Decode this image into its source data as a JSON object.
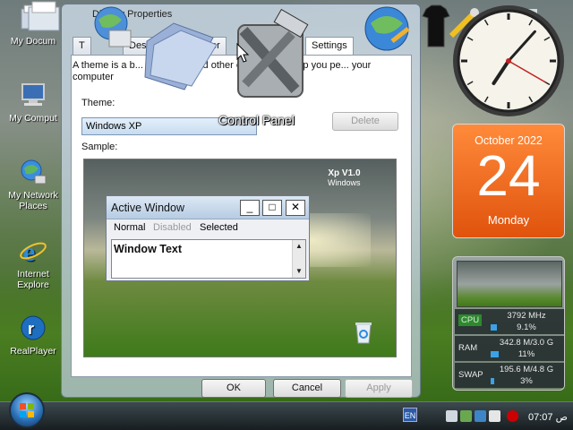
{
  "desktop": {
    "icons": [
      {
        "label": "My Docum"
      },
      {
        "label": "My Comput"
      },
      {
        "label": "My Network Places"
      },
      {
        "label": "Internet Explore"
      },
      {
        "label": "RealPlayer"
      }
    ]
  },
  "dialog": {
    "title": "Display Properties",
    "tabs": [
      "T",
      "Desk",
      "er",
      "A",
      "Settings"
    ],
    "description": "A theme is a b... a set of ... and other elements to help you pe... your computer",
    "theme_label": "Theme:",
    "theme_value": "Windows XP",
    "delete_label": "Delete",
    "sample_label": "Sample:",
    "ok_label": "OK",
    "cancel_label": "Cancel",
    "apply_label": "Apply"
  },
  "sample": {
    "logo_line1": "Xp V1.0",
    "logo_line2": "Windows",
    "active_window_title": "Active Window",
    "menu": [
      "Normal",
      "Disabled",
      "Selected"
    ],
    "window_text": "Window Text"
  },
  "overlay": {
    "control_panel_label": "Control Panel"
  },
  "calendar": {
    "month": "October 2022",
    "day": "24",
    "weekday": "Monday"
  },
  "meter": {
    "cpu": {
      "name": "CPU",
      "value": "3792 MHz",
      "percent": "9.1%",
      "fraction": 0.091
    },
    "ram": {
      "name": "RAM",
      "value": "342.8 M/3.0 G",
      "percent": "11%",
      "fraction": 0.11
    },
    "swap": {
      "name": "SWAP",
      "value": "195.6 M/4.8 G",
      "percent": "3%",
      "fraction": 0.03
    }
  },
  "clock": {
    "hour": 7,
    "minute": 7,
    "second": 20
  },
  "taskbar": {
    "lang": "EN",
    "time": "07:07",
    "ampm": "ص"
  },
  "colors": {
    "calendar_accent": "#f06a1e",
    "selection": "#c7dcf0"
  }
}
